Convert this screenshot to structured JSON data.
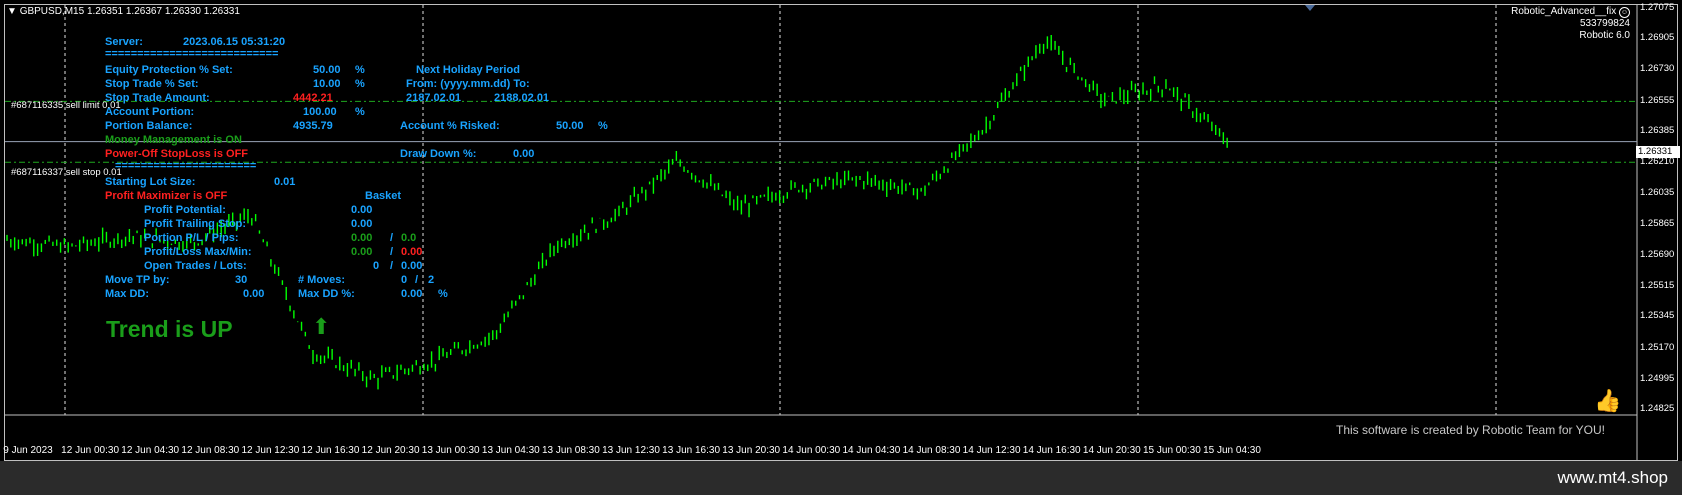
{
  "header": {
    "menu_glyph": "▼",
    "symbol": "GBPUSD,M15",
    "ohlc": [
      "1.26351",
      "1.26367",
      "1.26330",
      "1.26331"
    ]
  },
  "ea_info": {
    "name": "Robotic_Advanced__fix",
    "account": "533799824",
    "version": "Robotic 6.0"
  },
  "panel": {
    "server_label": "Server:",
    "server_time": "2023.06.15 05:31:20",
    "sep1": "===========================",
    "equity_label": "Equity Protection % Set:",
    "equity_value": "50.00",
    "equity_pct": "%",
    "stop_pct_label": "Stop Trade % Set:",
    "stop_pct_value": "10.00",
    "stop_pct_pct": "%",
    "stop_amt_label": "Stop Trade Amount:",
    "stop_amt_value": "4442.21",
    "acct_portion_label": "Account Portion:",
    "acct_portion_value": "100.00",
    "acct_portion_pct": "%",
    "portion_balance_label": "Portion Balance:",
    "portion_balance_value": "4935.79",
    "money_mgmt": "Money Management is ON",
    "power_off": "Power-Off StopLoss is OFF",
    "sep2": "======================",
    "holiday_title": "Next Holiday Period",
    "holiday_from_to": "From: (yyyy.mm.dd) To:",
    "holiday_from": "2187.02.01",
    "holiday_to": "2188.02.01",
    "risked_label": "Account % Risked:",
    "risked_value": "50.00",
    "risked_pct": "%",
    "drawdown_label": "Draw Down %:",
    "drawdown_value": "0.00",
    "lot_label": "Starting Lot Size:",
    "lot_value": "0.01",
    "maximizer": "Profit Maximizer is OFF",
    "basket": "Basket",
    "profit_potential_label": "Profit Potential:",
    "profit_potential_value": "0.00",
    "trailing_label": "Profit Trailing Stop:",
    "trailing_value": "0.00",
    "pl_label": "Portion P/L / Pips:",
    "pl_value": "0.00",
    "pl_slash": "/",
    "pl_pips": "0.0",
    "maxmin_label": "Profit/Loss Max/Min:",
    "max_value": "0.00",
    "maxmin_slash": "/",
    "min_value": "0.00",
    "open_label": "Open Trades / Lots:",
    "open_trades": "0",
    "open_slash": "/",
    "open_lots": "0.00",
    "move_tp_label": "Move TP by:",
    "move_tp_value": "30",
    "moves_label": "# Moves:",
    "moves_value": "0",
    "moves_slash": "/",
    "moves_max": "2",
    "max_dd_label": "Max DD:",
    "max_dd_value": "0.00",
    "max_dd_pct_label": "Max DD %:",
    "max_dd_pct_value": "0.00",
    "max_dd_pct_sign": "%"
  },
  "trend": {
    "text": "Trend is UP",
    "arrow_icon": "up-arrow-icon"
  },
  "orders": [
    {
      "label": "#687116335 sell limit 0.01",
      "price": 1.26557
    },
    {
      "label": "#687116337 sell stop 0.01",
      "price": 1.26215
    }
  ],
  "current_price": {
    "value": 1.26331,
    "label": "1.26331"
  },
  "price_axis": {
    "min": 1.24825,
    "max": 1.27075,
    "ticks": [
      "1.27075",
      "1.26905",
      "1.26730",
      "1.26555",
      "1.26385",
      "1.26210",
      "1.26035",
      "1.25865",
      "1.25690",
      "1.25515",
      "1.25345",
      "1.25170",
      "1.24995",
      "1.24825"
    ]
  },
  "time_axis": {
    "ticks": [
      "9 Jun 2023",
      "12 Jun 00:30",
      "12 Jun 04:30",
      "12 Jun 08:30",
      "12 Jun 12:30",
      "12 Jun 16:30",
      "12 Jun 20:30",
      "13 Jun 00:30",
      "13 Jun 04:30",
      "13 Jun 08:30",
      "13 Jun 12:30",
      "13 Jun 16:30",
      "13 Jun 20:30",
      "14 Jun 00:30",
      "14 Jun 04:30",
      "14 Jun 08:30",
      "14 Jun 12:30",
      "14 Jun 16:30",
      "14 Jun 20:30",
      "15 Jun 00:30",
      "15 Jun 04:30"
    ]
  },
  "credit": "This software is created by Robotic Team for YOU!",
  "watermark": "www.mt4.shop",
  "smiley_icon": "smiley-icon",
  "thumb_icon": "thumbs-up-icon",
  "colors": {
    "candle": "#00ff00",
    "label_blue": "#19a3ff",
    "red": "#ff2020",
    "green_text": "#1a9e1a",
    "order_line": "#1fa81f"
  },
  "chart_data": {
    "type": "line",
    "title": "GBPUSD,M15",
    "x": [
      "9 Jun 2023",
      "12 Jun 00:30",
      "12 Jun 04:30",
      "12 Jun 08:30",
      "12 Jun 12:30",
      "12 Jun 16:30",
      "12 Jun 20:30",
      "13 Jun 00:30",
      "13 Jun 04:30",
      "13 Jun 08:30",
      "13 Jun 12:30",
      "13 Jun 16:30",
      "13 Jun 20:30",
      "14 Jun 00:30",
      "14 Jun 04:30",
      "14 Jun 08:30",
      "14 Jun 12:30",
      "14 Jun 16:30",
      "14 Jun 20:30",
      "15 Jun 00:30",
      "15 Jun 04:30"
    ],
    "series": [
      {
        "values": [
          1.2578,
          1.2574,
          1.258,
          1.2576,
          1.2592,
          1.2515,
          1.25,
          1.251,
          1.2525,
          1.2575,
          1.2592,
          1.2622,
          1.2596,
          1.2608,
          1.2612,
          1.2605,
          1.264,
          1.269,
          1.2656,
          1.2665,
          1.2633
        ]
      }
    ],
    "ylim": [
      1.24825,
      1.27075
    ],
    "grid": true
  }
}
